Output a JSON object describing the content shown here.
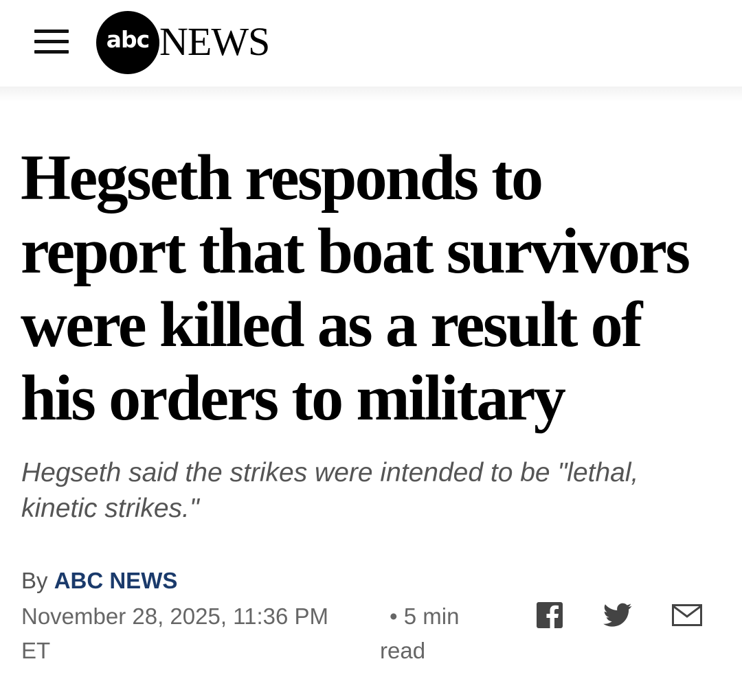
{
  "header": {
    "logo_abc": "abc",
    "logo_news": "NEWS",
    "menu_icon": "hamburger-menu-icon"
  },
  "article": {
    "headline_lines": [
      "Hegseth responds to",
      "report that boat survivors",
      "were killed as a result of",
      "his orders to military"
    ],
    "subhead_lines": [
      "Hegseth said the strikes were intended to be \"lethal,",
      "kinetic strikes.\""
    ],
    "byline_prefix": "By",
    "author": "ABC NEWS",
    "timestamp_lines": [
      "November 28, 2025, 11:36 PM",
      "ET"
    ],
    "read_time_lines": [
      "• 5 min",
      "read"
    ]
  },
  "share": {
    "icons": [
      "facebook-icon",
      "twitter-icon",
      "email-icon"
    ]
  },
  "colors": {
    "author_link": "#1a3a6b",
    "subhead": "#555555",
    "meta": "#666666",
    "icon": "#444444"
  }
}
